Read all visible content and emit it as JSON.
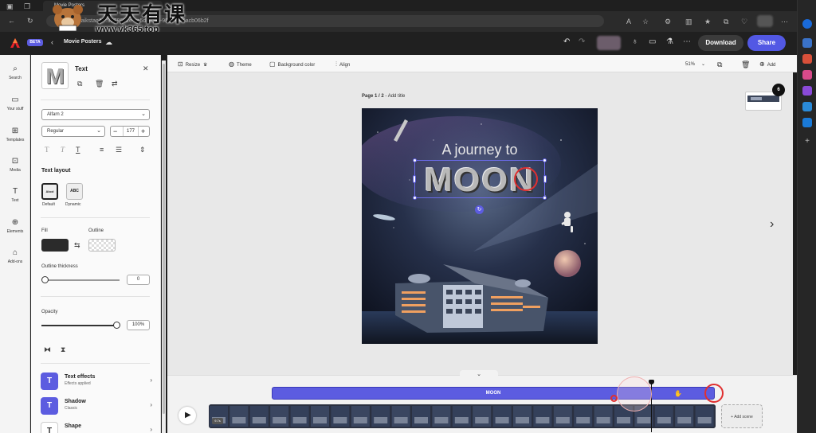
{
  "browser": {
    "tab_title": "Movie Posters",
    "address": "...haikstacAP:9278692e-ce5d-5ce6-98d7-0ff6acb06b2f",
    "watermark_cn": "天天有课",
    "watermark_url": "www.yk365.top"
  },
  "app": {
    "beta_label": "BETA",
    "project_title": "Movie Posters",
    "download_label": "Download",
    "share_label": "Share",
    "accent_color": "#5c5ce0"
  },
  "left_rail": {
    "items": [
      {
        "label": "Search",
        "icon": "search-icon"
      },
      {
        "label": "Your stuff",
        "icon": "folder-icon"
      },
      {
        "label": "Templates",
        "icon": "templates-icon"
      },
      {
        "label": "Media",
        "icon": "media-icon"
      },
      {
        "label": "Text",
        "icon": "text-icon"
      },
      {
        "label": "Elements",
        "icon": "elements-icon"
      },
      {
        "label": "Add-ons",
        "icon": "addons-icon"
      }
    ]
  },
  "props": {
    "panel_title": "Text",
    "thumb_text": "M",
    "font_family": "Alfarn 2",
    "font_style": "Regular",
    "font_size": "177",
    "text_layout_label": "Text layout",
    "layout_default": "Default",
    "layout_dynamic": "Dynamic",
    "layout_default_sample": "Abcd",
    "layout_dynamic_sample": "ABC",
    "fill_label": "Fill",
    "outline_label": "Outline",
    "fill_color": "#2b2b2b",
    "outline_thickness_label": "Outline thickness",
    "outline_thickness_value": "0",
    "outline_thickness_level": 0,
    "opacity_label": "Opacity",
    "opacity_value": "100%",
    "opacity_level": 1.0,
    "effects": [
      {
        "title": "Text effects",
        "sub": "Effects applied",
        "icon": "T"
      },
      {
        "title": "Shadow",
        "sub": "Classic",
        "icon": "T"
      },
      {
        "title": "Shape",
        "sub": "",
        "icon": "T"
      }
    ]
  },
  "toolbar": {
    "resize_label": "Resize",
    "theme_label": "Theme",
    "background_color_label": "Background color",
    "align_label": "Align",
    "zoom_label": "51%",
    "add_label": "Add"
  },
  "canvas": {
    "page_label_bold": "Page 1 / 2",
    "page_label_rest": " - Add title",
    "poster_line1": "A journey to",
    "poster_line2": "MOON",
    "page_count": "6"
  },
  "timeline": {
    "text_track_label": "MOON",
    "add_scene_label": "+ Add scene",
    "duration_label": "9.7s"
  }
}
